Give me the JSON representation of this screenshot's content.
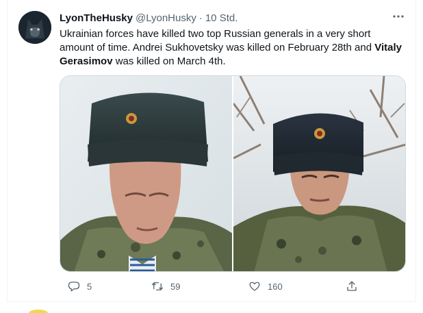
{
  "tweet": {
    "display_name": "LyonTheHusky",
    "handle": "@LyonHusky",
    "separator": "·",
    "time": "10 Std.",
    "text_part1": "Ukrainian forces have killed two top Russian generals in a very short amount of time. Andrei Sukhovetsky was killed on February 28th and ",
    "text_bold": "Vitaly Gerasimov",
    "text_part2": " was killed on March 4th."
  },
  "actions": {
    "replies": "5",
    "retweets": "59",
    "likes": "160"
  },
  "icons": {
    "more": "more-icon",
    "reply": "reply-icon",
    "retweet": "retweet-icon",
    "like": "like-icon",
    "share": "share-icon"
  },
  "colors": {
    "text": "#0f1419",
    "secondary": "#536471",
    "border": "#cfd9de"
  }
}
